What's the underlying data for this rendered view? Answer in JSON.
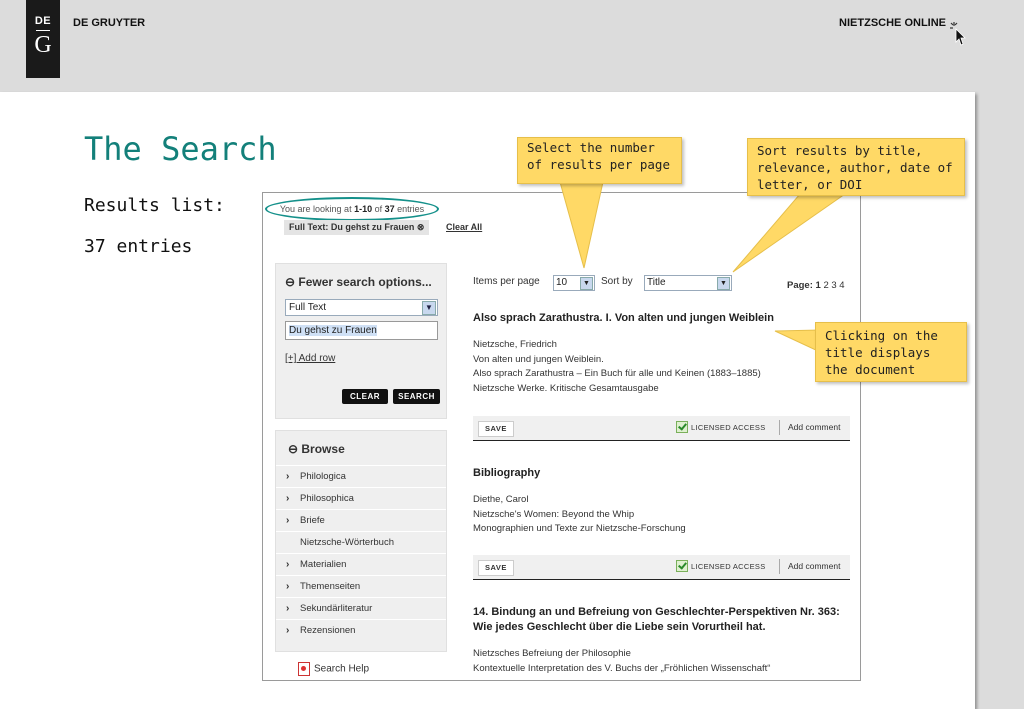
{
  "header": {
    "logo_top": "DE",
    "logo_bottom": "G",
    "brand": "DE GRUYTER",
    "product": "NIETZSCHE ONLINE"
  },
  "slide": {
    "title": "The Search",
    "results_label": "Results list:",
    "entries_label": "37 entries"
  },
  "callouts": {
    "per_page": "Select the number of results per page",
    "sort": "Sort results by title, relevance, author, date of letter, or DOI",
    "title_click": "Clicking on the title displays the document"
  },
  "screen": {
    "looking_prefix": "You are looking at ",
    "looking_range": "1-10",
    "looking_mid": " of ",
    "looking_total": "37",
    "looking_suffix": " entries",
    "filter_chip": "Full Text: Du gehst zu Frauen ⊗",
    "clear_all": "Clear All",
    "search_panel": {
      "heading": "⊖ Fewer search options...",
      "field_select": "Full Text",
      "query_value": "Du gehst zu Frauen",
      "add_row": "[+] Add row",
      "clear_button": "CLEAR",
      "search_button": "SEARCH"
    },
    "browse": {
      "heading": "⊖ Browse",
      "items": [
        {
          "chev": "›",
          "label": "Philologica"
        },
        {
          "chev": "›",
          "label": "Philosophica"
        },
        {
          "chev": "›",
          "label": "Briefe"
        },
        {
          "chev": "",
          "label": "Nietzsche-Wörterbuch"
        },
        {
          "chev": "›",
          "label": "Materialien"
        },
        {
          "chev": "›",
          "label": "Themenseiten"
        },
        {
          "chev": "›",
          "label": "Sekundärliteratur"
        },
        {
          "chev": "›",
          "label": "Rezensionen"
        }
      ]
    },
    "search_help": "Search Help",
    "toolbar": {
      "items_per_page_label": "Items per page",
      "items_per_page_value": "10",
      "sort_by_label": "Sort by",
      "sort_by_value": "Title",
      "page_label": "Page:",
      "current_page": "1",
      "other_pages": "2 3 4"
    },
    "results": [
      {
        "title": "Also sprach Zarathustra. I. Von alten und jungen Weiblein",
        "lines": [
          "Nietzsche, Friedrich",
          "Von alten und jungen Weiblein.",
          "Also sprach Zarathustra – Ein Buch für alle und Keinen (1883–1885)",
          "Nietzsche Werke. Kritische Gesamtausgabe"
        ]
      },
      {
        "title": "Bibliography",
        "lines": [
          "Diethe, Carol",
          "Nietzsche's Women: Beyond the Whip",
          "Monographien und Texte zur Nietzsche-Forschung"
        ]
      },
      {
        "title": "14. Bindung an und Befreiung von Geschlechter-Perspektiven Nr. 363: Wie jedes Geschlecht über die Liebe sein Vorurtheil hat.",
        "lines": [
          "Nietzsches Befreiung der Philosophie",
          "Kontextuelle Interpretation des V. Buchs der „Fröhlichen Wissenschaft“"
        ]
      }
    ],
    "actions": {
      "save": "SAVE",
      "licensed": "LICENSED ACCESS",
      "add_comment": "Add comment"
    }
  },
  "colors": {
    "title_teal": "#13807a",
    "callout_yellow": "#ffd966",
    "highlight_oval": "#14908a"
  }
}
